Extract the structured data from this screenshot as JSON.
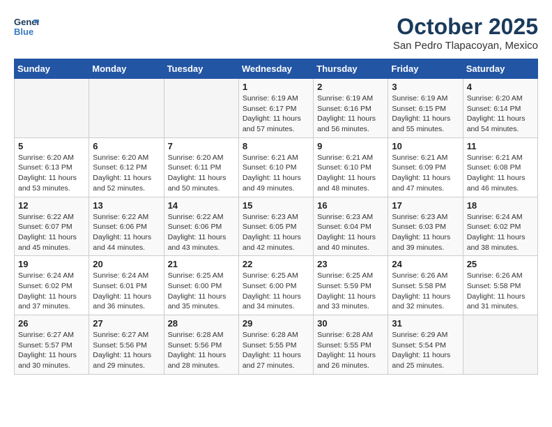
{
  "header": {
    "logo_line1": "General",
    "logo_line2": "Blue",
    "month": "October 2025",
    "location": "San Pedro Tlapacoyan, Mexico"
  },
  "weekdays": [
    "Sunday",
    "Monday",
    "Tuesday",
    "Wednesday",
    "Thursday",
    "Friday",
    "Saturday"
  ],
  "weeks": [
    [
      {
        "num": "",
        "info": ""
      },
      {
        "num": "",
        "info": ""
      },
      {
        "num": "",
        "info": ""
      },
      {
        "num": "1",
        "info": "Sunrise: 6:19 AM\nSunset: 6:17 PM\nDaylight: 11 hours and 57 minutes."
      },
      {
        "num": "2",
        "info": "Sunrise: 6:19 AM\nSunset: 6:16 PM\nDaylight: 11 hours and 56 minutes."
      },
      {
        "num": "3",
        "info": "Sunrise: 6:19 AM\nSunset: 6:15 PM\nDaylight: 11 hours and 55 minutes."
      },
      {
        "num": "4",
        "info": "Sunrise: 6:20 AM\nSunset: 6:14 PM\nDaylight: 11 hours and 54 minutes."
      }
    ],
    [
      {
        "num": "5",
        "info": "Sunrise: 6:20 AM\nSunset: 6:13 PM\nDaylight: 11 hours and 53 minutes."
      },
      {
        "num": "6",
        "info": "Sunrise: 6:20 AM\nSunset: 6:12 PM\nDaylight: 11 hours and 52 minutes."
      },
      {
        "num": "7",
        "info": "Sunrise: 6:20 AM\nSunset: 6:11 PM\nDaylight: 11 hours and 50 minutes."
      },
      {
        "num": "8",
        "info": "Sunrise: 6:21 AM\nSunset: 6:10 PM\nDaylight: 11 hours and 49 minutes."
      },
      {
        "num": "9",
        "info": "Sunrise: 6:21 AM\nSunset: 6:10 PM\nDaylight: 11 hours and 48 minutes."
      },
      {
        "num": "10",
        "info": "Sunrise: 6:21 AM\nSunset: 6:09 PM\nDaylight: 11 hours and 47 minutes."
      },
      {
        "num": "11",
        "info": "Sunrise: 6:21 AM\nSunset: 6:08 PM\nDaylight: 11 hours and 46 minutes."
      }
    ],
    [
      {
        "num": "12",
        "info": "Sunrise: 6:22 AM\nSunset: 6:07 PM\nDaylight: 11 hours and 45 minutes."
      },
      {
        "num": "13",
        "info": "Sunrise: 6:22 AM\nSunset: 6:06 PM\nDaylight: 11 hours and 44 minutes."
      },
      {
        "num": "14",
        "info": "Sunrise: 6:22 AM\nSunset: 6:06 PM\nDaylight: 11 hours and 43 minutes."
      },
      {
        "num": "15",
        "info": "Sunrise: 6:23 AM\nSunset: 6:05 PM\nDaylight: 11 hours and 42 minutes."
      },
      {
        "num": "16",
        "info": "Sunrise: 6:23 AM\nSunset: 6:04 PM\nDaylight: 11 hours and 40 minutes."
      },
      {
        "num": "17",
        "info": "Sunrise: 6:23 AM\nSunset: 6:03 PM\nDaylight: 11 hours and 39 minutes."
      },
      {
        "num": "18",
        "info": "Sunrise: 6:24 AM\nSunset: 6:02 PM\nDaylight: 11 hours and 38 minutes."
      }
    ],
    [
      {
        "num": "19",
        "info": "Sunrise: 6:24 AM\nSunset: 6:02 PM\nDaylight: 11 hours and 37 minutes."
      },
      {
        "num": "20",
        "info": "Sunrise: 6:24 AM\nSunset: 6:01 PM\nDaylight: 11 hours and 36 minutes."
      },
      {
        "num": "21",
        "info": "Sunrise: 6:25 AM\nSunset: 6:00 PM\nDaylight: 11 hours and 35 minutes."
      },
      {
        "num": "22",
        "info": "Sunrise: 6:25 AM\nSunset: 6:00 PM\nDaylight: 11 hours and 34 minutes."
      },
      {
        "num": "23",
        "info": "Sunrise: 6:25 AM\nSunset: 5:59 PM\nDaylight: 11 hours and 33 minutes."
      },
      {
        "num": "24",
        "info": "Sunrise: 6:26 AM\nSunset: 5:58 PM\nDaylight: 11 hours and 32 minutes."
      },
      {
        "num": "25",
        "info": "Sunrise: 6:26 AM\nSunset: 5:58 PM\nDaylight: 11 hours and 31 minutes."
      }
    ],
    [
      {
        "num": "26",
        "info": "Sunrise: 6:27 AM\nSunset: 5:57 PM\nDaylight: 11 hours and 30 minutes."
      },
      {
        "num": "27",
        "info": "Sunrise: 6:27 AM\nSunset: 5:56 PM\nDaylight: 11 hours and 29 minutes."
      },
      {
        "num": "28",
        "info": "Sunrise: 6:28 AM\nSunset: 5:56 PM\nDaylight: 11 hours and 28 minutes."
      },
      {
        "num": "29",
        "info": "Sunrise: 6:28 AM\nSunset: 5:55 PM\nDaylight: 11 hours and 27 minutes."
      },
      {
        "num": "30",
        "info": "Sunrise: 6:28 AM\nSunset: 5:55 PM\nDaylight: 11 hours and 26 minutes."
      },
      {
        "num": "31",
        "info": "Sunrise: 6:29 AM\nSunset: 5:54 PM\nDaylight: 11 hours and 25 minutes."
      },
      {
        "num": "",
        "info": ""
      }
    ]
  ]
}
